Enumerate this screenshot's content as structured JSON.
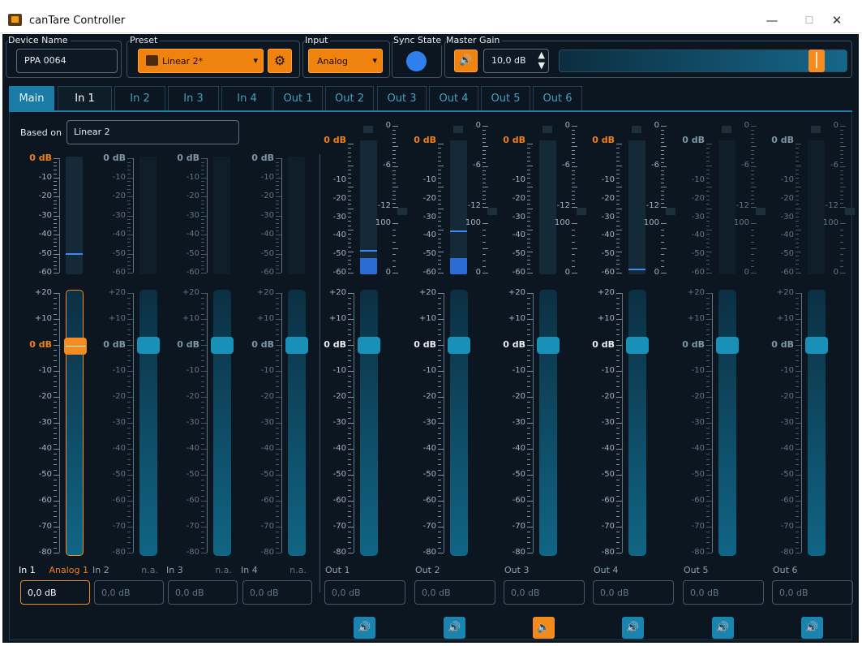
{
  "window": {
    "title": "canTare Controller",
    "min": "—",
    "max": "☐",
    "close": "✕"
  },
  "toolbar": {
    "device_name": {
      "label": "Device Name",
      "value": "PPA 0064"
    },
    "preset": {
      "label": "Preset",
      "value": "Linear 2*",
      "arrow": "▾",
      "settings_glyph": "⚙"
    },
    "input": {
      "label": "Input",
      "value": "Analog",
      "arrow": "▾"
    },
    "sync_state": {
      "label": "Sync State",
      "color": "#2f80ed"
    },
    "master_gain": {
      "label": "Master Gain",
      "value": "10,0 dB",
      "spin_up": "▲",
      "spin_down": "▼",
      "slider_fraction": 0.92
    }
  },
  "tabs": [
    "Main",
    "In 1",
    "In 2",
    "In 3",
    "In 4",
    "Out 1",
    "Out 2",
    "Out 3",
    "Out 4",
    "Out 5",
    "Out 6"
  ],
  "based_on": {
    "label": "Based on",
    "value": "Linear 2"
  },
  "scales": {
    "meter_db": [
      "0 dB",
      "-10",
      "-20",
      "-30",
      "-40",
      "-50",
      "-60"
    ],
    "limiter": [
      "0",
      "-6",
      "-12"
    ],
    "percent": [
      "100",
      "0"
    ],
    "fader_db": [
      "+20",
      "+10",
      "0 dB",
      "-10",
      "-20",
      "-30",
      "-40",
      "-50",
      "-60",
      "-70",
      "-80"
    ]
  },
  "inputs": [
    {
      "name": "In 1",
      "source": "Analog 1",
      "gain": "0,0 dB",
      "selected": true,
      "meter_level_db": -50
    },
    {
      "name": "In 2",
      "source": "n.a.",
      "gain": "0,0 dB",
      "selected": false
    },
    {
      "name": "In 3",
      "source": "n.a.",
      "gain": "0,0 dB",
      "selected": false
    },
    {
      "name": "In 4",
      "source": "n.a.",
      "gain": "0,0 dB",
      "selected": false
    }
  ],
  "outputs": [
    {
      "name": "Out 1",
      "gain": "0,0 dB",
      "active": true,
      "meter_level_db": -48,
      "fill_db": -54,
      "muted": false,
      "mute_icon": "🔊"
    },
    {
      "name": "Out 2",
      "gain": "0,0 dB",
      "active": true,
      "meter_level_db": -38,
      "fill_db": -54,
      "muted": false,
      "mute_icon": "🔊"
    },
    {
      "name": "Out 3",
      "gain": "0,0 dB",
      "active": true,
      "muted": true,
      "mute_icon": "🔈"
    },
    {
      "name": "Out 4",
      "gain": "0,0 dB",
      "active": true,
      "meter_level_db": -58,
      "muted": false,
      "mute_icon": "🔊"
    },
    {
      "name": "Out 5",
      "gain": "0,0 dB",
      "active": false,
      "muted": false,
      "mute_icon": "🔊"
    },
    {
      "name": "Out 6",
      "gain": "0,0 dB",
      "active": false,
      "muted": false,
      "mute_icon": "🔊"
    }
  ],
  "colors": {
    "accent": "#f68b1f",
    "primary": "#1890b8",
    "background": "#0b1620"
  }
}
